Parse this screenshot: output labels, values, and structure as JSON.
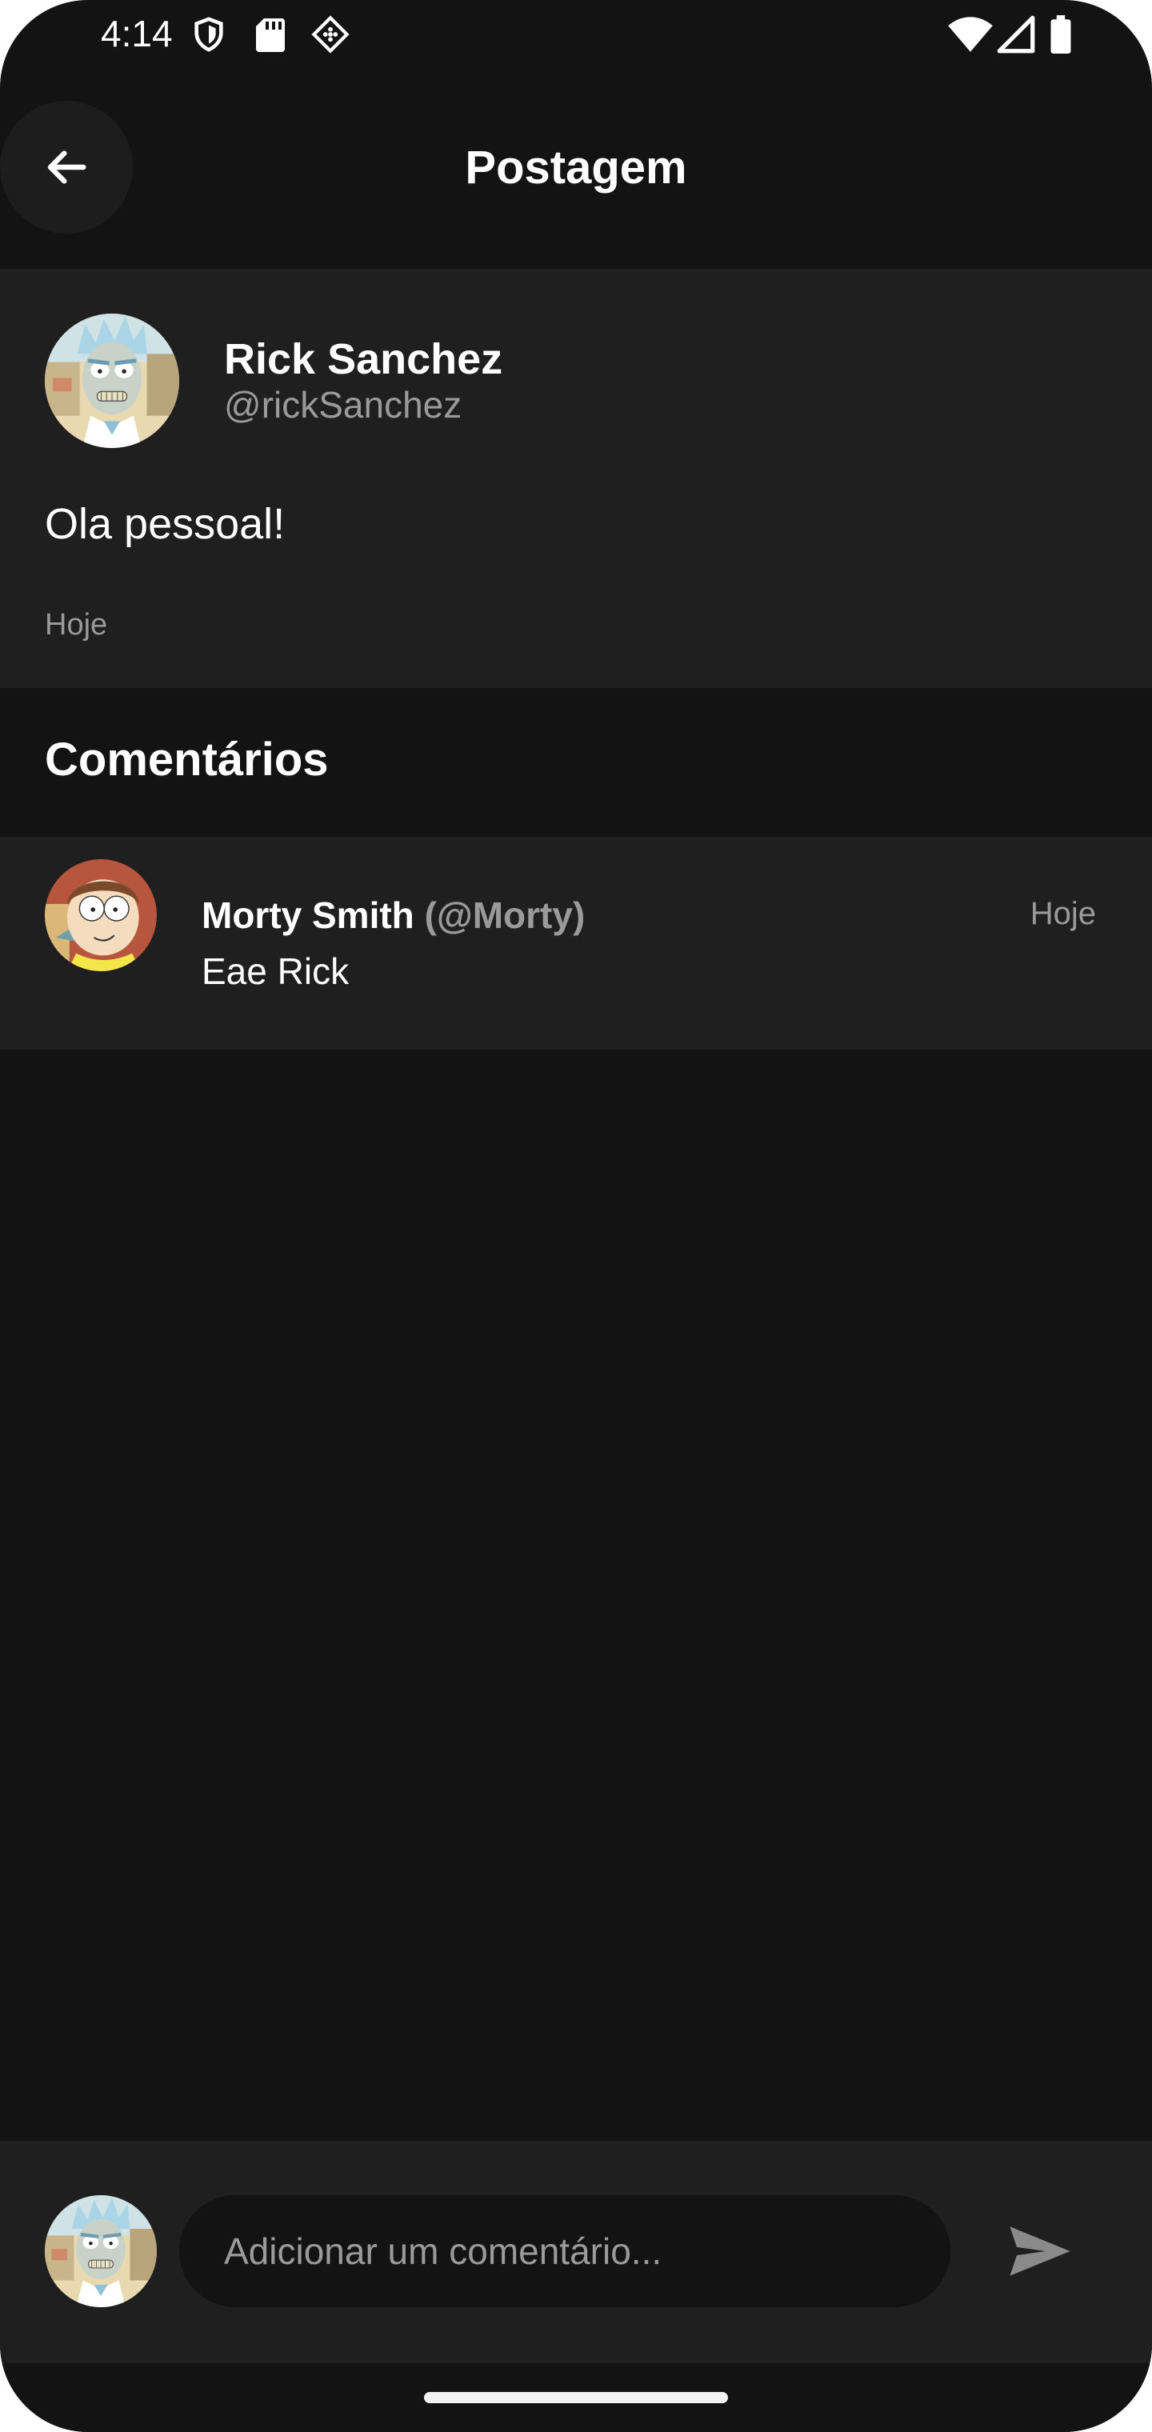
{
  "status_bar": {
    "time": "4:14",
    "icons": [
      "shield-icon",
      "sd-card-icon",
      "app-notification-icon",
      "wifi-icon",
      "signal-icon",
      "battery-icon"
    ]
  },
  "app_bar": {
    "title": "Postagem",
    "back_icon": "arrow-back-icon"
  },
  "post": {
    "author_name": "Rick Sanchez",
    "author_handle": "@rickSanchez",
    "text": "Ola pessoal!",
    "date": "Hoje"
  },
  "comments_section": {
    "title": "Comentários",
    "items": [
      {
        "author_name": "Morty Smith",
        "author_handle": "(@Morty)",
        "text": "Eae Rick",
        "date": "Hoje"
      }
    ]
  },
  "composer": {
    "placeholder": "Adicionar um comentário...",
    "value": "",
    "send_icon": "send-icon"
  },
  "colors": {
    "background": "#131313",
    "surface": "#1f1f1f",
    "text_primary": "#ffffff",
    "text_secondary": "#9a9a9a"
  }
}
